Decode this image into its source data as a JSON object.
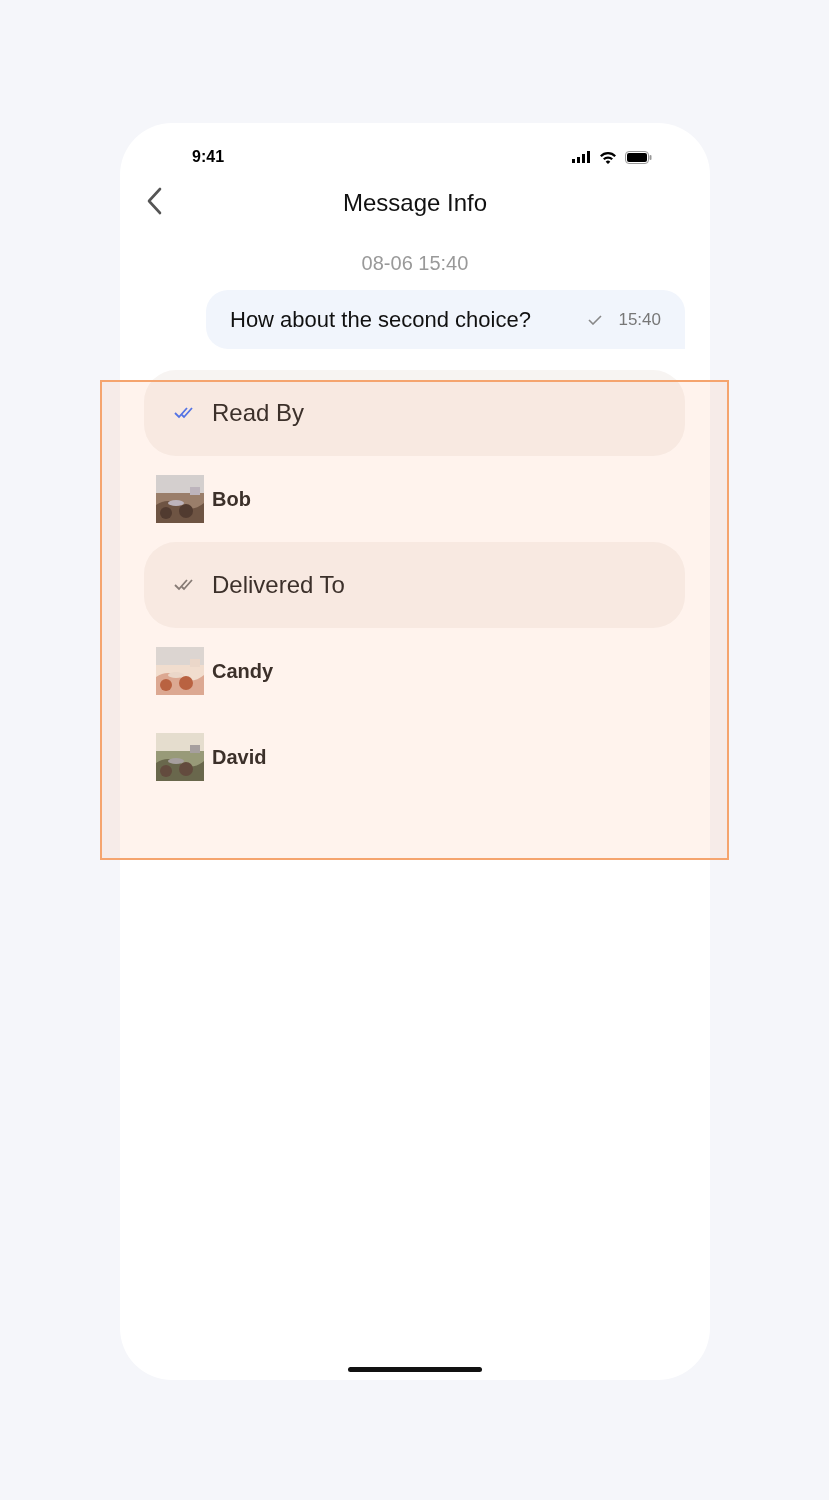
{
  "status_bar": {
    "time": "9:41"
  },
  "header": {
    "title": "Message Info"
  },
  "message": {
    "date": "08-06 15:40",
    "text": "How about the second choice?",
    "time": "15:40"
  },
  "sections": [
    {
      "kind": "read",
      "label": "Read By",
      "members": [
        {
          "name": "Bob"
        }
      ]
    },
    {
      "kind": "delivered",
      "label": "Delivered To",
      "members": [
        {
          "name": "Candy"
        },
        {
          "name": "David"
        }
      ]
    }
  ]
}
